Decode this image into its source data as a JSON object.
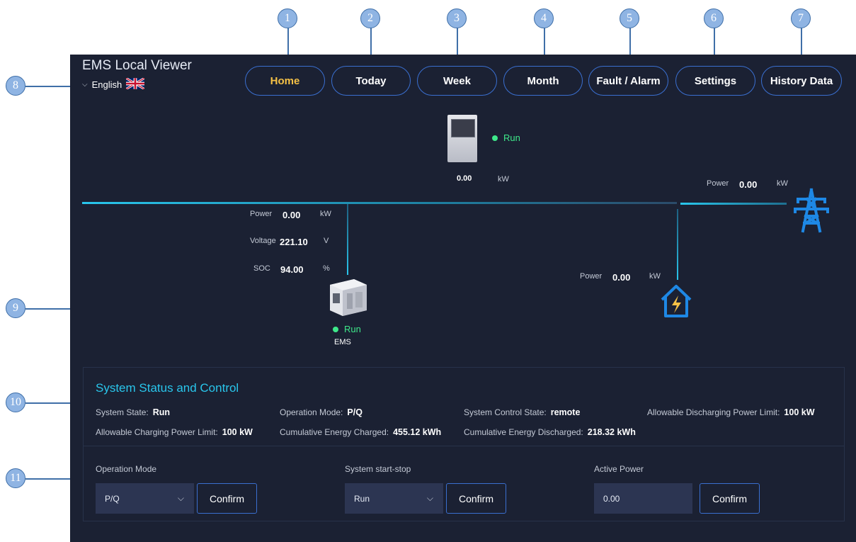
{
  "app": {
    "title": "EMS Local Viewer",
    "language": "English"
  },
  "nav": [
    {
      "label": "Home",
      "active": true
    },
    {
      "label": "Today"
    },
    {
      "label": "Week"
    },
    {
      "label": "Month"
    },
    {
      "label": "Fault / Alarm"
    },
    {
      "label": "Settings"
    },
    {
      "label": "History Data"
    }
  ],
  "callouts": [
    "1",
    "2",
    "3",
    "4",
    "5",
    "6",
    "7",
    "8",
    "9",
    "10",
    "11"
  ],
  "meter": {
    "status": "Run",
    "value": "0.00",
    "unit": "kW"
  },
  "grid": {
    "label": "Power",
    "value": "0.00",
    "unit": "kW",
    "icon": "power-tower-icon"
  },
  "storage": {
    "power_label": "Power",
    "power_value": "0.00",
    "power_unit": "kW",
    "voltage_label": "Voltage",
    "voltage_value": "221.10",
    "voltage_unit": "V",
    "soc_label": "SOC",
    "soc_value": "94.00",
    "soc_unit": "%",
    "status": "Run",
    "name": "EMS"
  },
  "load": {
    "label": "Power",
    "value": "0.00",
    "unit": "kW",
    "icon": "home-lightning-icon"
  },
  "status_panel": {
    "title": "System Status and Control",
    "items": [
      {
        "label": "System State:",
        "value": "Run"
      },
      {
        "label": "Operation Mode:",
        "value": "P/Q"
      },
      {
        "label": "System Control State:",
        "value": "remote"
      },
      {
        "label": "Allowable Discharging Power Limit:",
        "value": "100 kW"
      },
      {
        "label": "Allowable Charging Power Limit:",
        "value": "100 kW"
      },
      {
        "label": "Cumulative Energy Charged:",
        "value": "455.12 kWh"
      },
      {
        "label": "Cumulative Energy Discharged:",
        "value": "218.32 kWh"
      }
    ]
  },
  "controls": {
    "operation_mode": {
      "label": "Operation Mode",
      "value": "P/Q",
      "confirm": "Confirm"
    },
    "start_stop": {
      "label": "System start-stop",
      "value": "Run",
      "confirm": "Confirm"
    },
    "active_power": {
      "label": "Active Power",
      "value": "0.00",
      "confirm": "Confirm"
    }
  },
  "colors": {
    "bg": "#1b2133",
    "accent": "#29c6ec",
    "run": "#3ee88a",
    "active_nav": "#f5c146",
    "border": "#3a6fd0",
    "icon": "#1e88e5"
  }
}
